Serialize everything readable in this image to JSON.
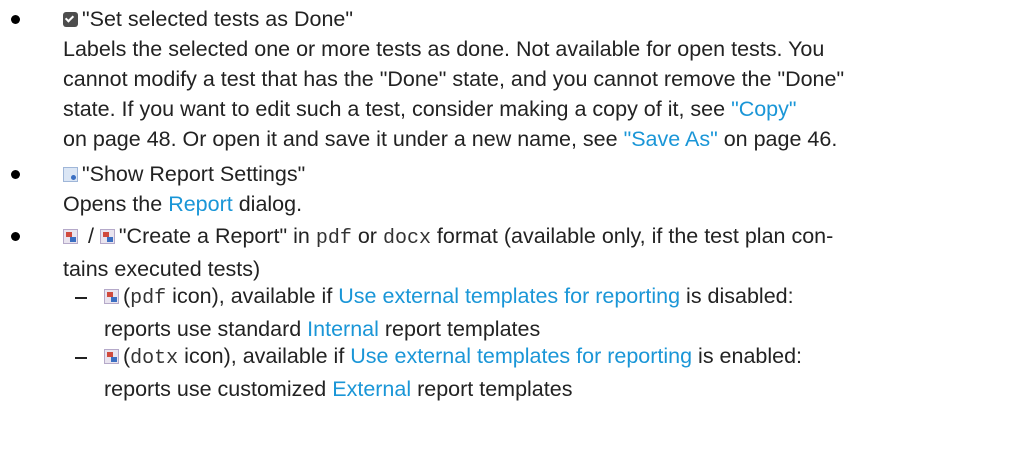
{
  "items": [
    {
      "icon": "done-check-icon",
      "title": "\"Set selected tests as Done\"",
      "lines": [
        "Labels the selected one or more tests as done. Not available for open tests. You",
        "cannot modify a test that has the \"Done\" state, and you cannot remove the \"Done\"",
        "state. If you want to edit such a test, consider making a copy of it, see"
      ],
      "link_copy": "\"Copy\"",
      "copy_tail_1": "on page 48. Or open it and save it under a new name, see",
      "link_save_as": "\"Save As\"",
      "copy_tail_2": " on page 46."
    },
    {
      "icon": "report-settings-icon",
      "title": "\"Show Report Settings\"",
      "pre": "Opens the ",
      "link_report": "Report",
      "post": " dialog."
    },
    {
      "icon": "create-report-icon",
      "slash": " / ",
      "title": "\"Create a Report\" in ",
      "fmt_pdf": "pdf",
      "or_text": " or ",
      "fmt_docx": "docx",
      "tail": " format (available only, if the test plan con-",
      "line2": "tains executed tests)",
      "sub": [
        {
          "icon": "create-report-icon",
          "pre": "(",
          "mono": "pdf",
          "mid": " icon), available if ",
          "link": "Use external templates for reporting",
          "post": " is disabled:",
          "line2_pre": "reports use standard ",
          "line2_link": "Internal",
          "line2_post": " report templates"
        },
        {
          "icon": "create-report-icon",
          "pre": "(",
          "mono": "dotx",
          "mid": " icon), available if ",
          "link": "Use external templates for reporting",
          "post": " is enabled:",
          "line2_pre": "reports use customized ",
          "line2_link": "External",
          "line2_post": " report templates"
        }
      ]
    }
  ],
  "colors": {
    "text": "#222222",
    "link": "#1a96d7",
    "background": "#ffffff"
  }
}
